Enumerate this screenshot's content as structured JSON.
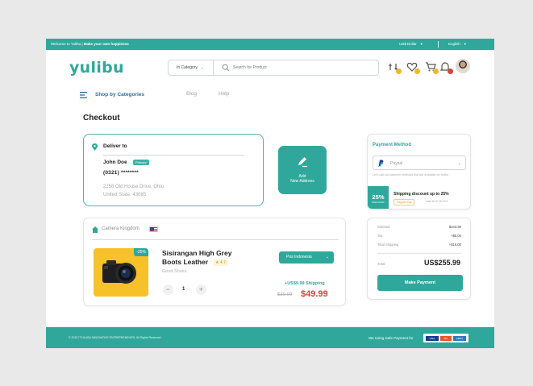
{
  "topbar": {
    "welcome": "Welcome to Yulibu |",
    "tagline": "Make your own happiness",
    "currency": "US$ Dollar",
    "language": "English"
  },
  "header": {
    "logo": "yulibu",
    "category_select": "In Category",
    "search_placeholder": "Search for Product"
  },
  "nav": {
    "shop_by_categories": "Shop by Categories",
    "links": [
      "Blog",
      "Help"
    ]
  },
  "page_title": "Checkout",
  "deliver": {
    "title": "Deliver to",
    "name": "John Doe",
    "primary_badge": "Primary",
    "phone": "(0321) ********",
    "address_line1": "2258 Old House Drive, Ohio",
    "address_line2": "United State, 43085"
  },
  "add_address": {
    "line1": "Add",
    "line2": "New Address"
  },
  "payment_method": {
    "title": "Payment Method",
    "selected": "Paypal",
    "note": "Let's use our payment methods that are available on Yulibu",
    "discount_pct": "25%",
    "discount_label": "DISCOUNT",
    "discount_text": "Shipping discount up to 25%",
    "chip": "Paypal only",
    "valid": "Valid till 20.08.2022"
  },
  "product": {
    "shop": "Camera Kingdom",
    "discount_badge": "-25%",
    "name": "Sisirangan High Grey Boots Leather",
    "rating": "★ 4.7",
    "category": "Good Shoes",
    "quantity": "1",
    "shipping_option": "Pos Indonesia",
    "shipping_fee": "+US$9.99 Shipping",
    "old_price": "$39.99",
    "price": "$49.99"
  },
  "summary": {
    "rows": [
      {
        "label": "Subtotal",
        "value": "$244.99"
      },
      {
        "label": "Tax",
        "value": "+$5.00"
      },
      {
        "label": "Total Shipping",
        "value": "+$18.00"
      }
    ],
    "total_label": "Total",
    "total_value": "US$255.99",
    "pay_button": "Make Payment"
  },
  "footer": {
    "copyright": "© 2022 ITYULIBU INNOVATIVE ENTREPRENEURS. All Rights Reserved",
    "safe_payment": "We Using Safe Payment for",
    "cards": [
      "VISA",
      "MC",
      "AMEX"
    ]
  },
  "colors": {
    "accent": "#2fa89b",
    "price": "#d5443a",
    "rating": "#d59a1b"
  }
}
